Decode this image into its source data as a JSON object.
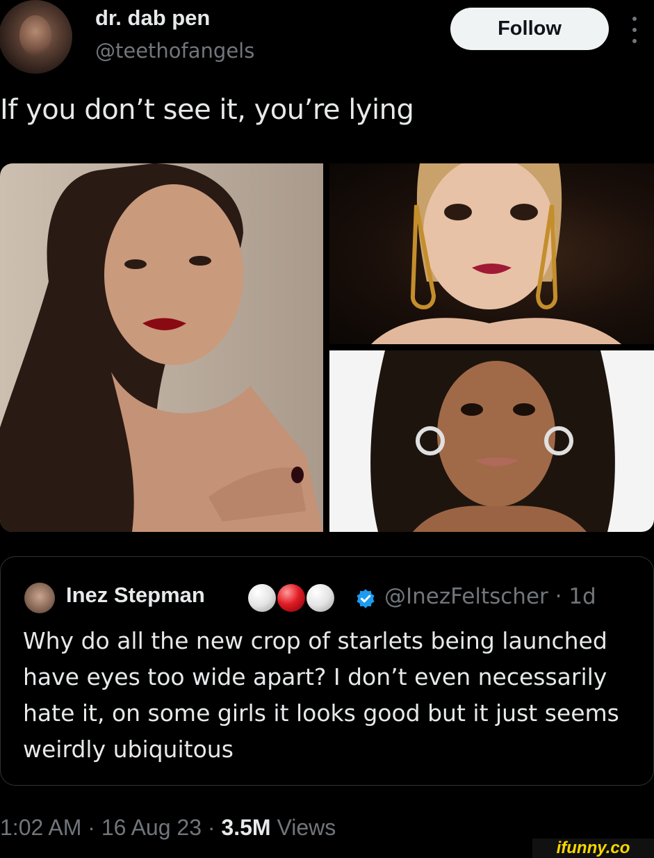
{
  "tweet": {
    "display_name": "dr. dab pen",
    "handle": "@teethofangels",
    "follow_label": "Follow",
    "text": "If you don’t see it, you’re lying"
  },
  "quoted_tweet": {
    "display_name": "Inez Stepman",
    "handle_and_time": "@InezFeltscher · 1d",
    "text": "Why do all the new crop of starlets being launched have eyes too wide apart? I don’t even necessarily hate it, on some girls it looks good but it just seems weirdly ubiquitous"
  },
  "meta": {
    "time": "1:02 AM",
    "date": "16 Aug 23",
    "views_count": "3.5M",
    "views_label": "Views"
  },
  "watermark": "ifunny.co",
  "colors": {
    "background": "#000000",
    "text_primary": "#e7e9ea",
    "text_secondary": "#71767b",
    "verified_blue": "#1d9bf0",
    "watermark": "#f7d700"
  }
}
